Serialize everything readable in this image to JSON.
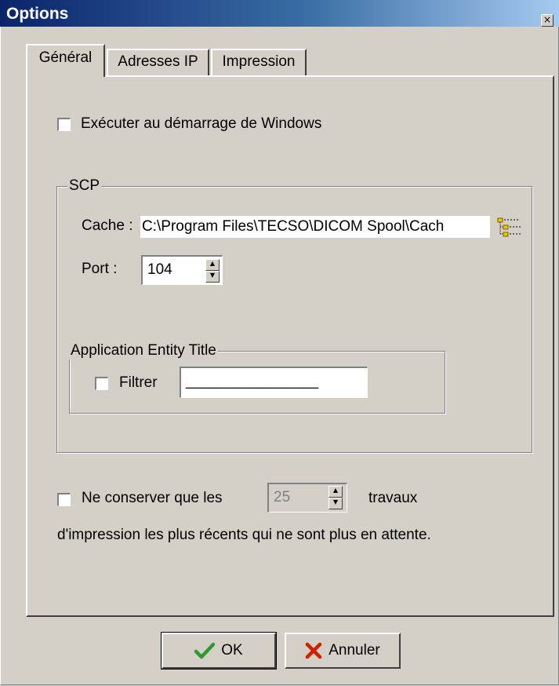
{
  "window": {
    "title": "Options",
    "close_glyph": "×"
  },
  "tabs": [
    {
      "label": "Général",
      "active": true
    },
    {
      "label": "Adresses IP",
      "active": false
    },
    {
      "label": "Impression",
      "active": false
    }
  ],
  "general": {
    "startup_checkbox": {
      "label": "Exécuter au démarrage de Windows",
      "checked": false
    },
    "scp_group": {
      "legend": "SCP",
      "cache_label": "Cache :",
      "cache_value": "C:\\Program Files\\TECSO\\DICOM Spool\\Cach",
      "browse_icon": "folder-tree-icon",
      "port_label": "Port :",
      "port_value": "104",
      "aet_group": {
        "legend": "Application Entity Title",
        "filter_label": "Filtrer",
        "filter_checked": false,
        "aet_value": "________________"
      }
    },
    "keep_jobs": {
      "label_before": "Ne conserver que les",
      "count_value": "25",
      "label_after": "travaux",
      "label_line2": "d'impression les plus récents qui ne sont plus en attente.",
      "checked": false
    }
  },
  "buttons": {
    "ok_label": "OK",
    "cancel_label": "Annuler",
    "ok_icon": "checkmark-icon",
    "cancel_icon": "x-icon"
  },
  "colors": {
    "titlebar_start": "#0a246a",
    "titlebar_end": "#a6caf0",
    "face": "#d4d0c8",
    "ok_check": "#2e9a2e",
    "cancel_x": "#cc2200"
  }
}
